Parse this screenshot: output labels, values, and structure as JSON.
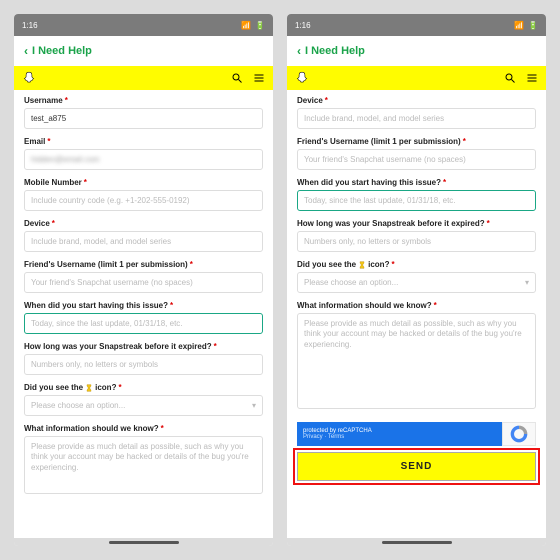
{
  "status": {
    "time": "1:16",
    "wifi": "⊙",
    "battery": "▮"
  },
  "nav": {
    "back": "‹",
    "title": "I Need Help"
  },
  "left": {
    "username_label": "Username",
    "username_value": "test_a875",
    "email_label": "Email",
    "email_value": "hidden@email.com",
    "mobile_label": "Mobile Number",
    "mobile_placeholder": "Include country code (e.g. +1-202-555-0192)",
    "device_label": "Device",
    "device_placeholder": "Include brand, model, and model series",
    "friend_label": "Friend's Username (limit 1 per submission)",
    "friend_placeholder": "Your friend's Snapchat username (no spaces)",
    "when_label": "When did you start having this issue?",
    "when_placeholder": "Today, since the last update, 01/31/18, etc.",
    "howlong_label": "How long was your Snapstreak before it expired?",
    "howlong_placeholder": "Numbers only, no letters or symbols",
    "hourglass_label_before": "Did you see the ",
    "hourglass_label_after": " icon?",
    "select_placeholder": "Please choose an option...",
    "info_label": "What information should we know?",
    "info_placeholder": "Please provide as much detail as possible, such as why you think your account may be hacked or details of the bug you're experiencing."
  },
  "right": {
    "device_label": "Device",
    "device_placeholder": "Include brand, model, and model series",
    "friend_label": "Friend's Username (limit 1 per submission)",
    "friend_placeholder": "Your friend's Snapchat username (no spaces)",
    "when_label": "When did you start having this issue?",
    "when_placeholder": "Today, since the last update, 01/31/18, etc.",
    "howlong_label": "How long was your Snapstreak before it expired?",
    "howlong_placeholder": "Numbers only, no letters or symbols",
    "hourglass_label_before": "Did you see the ",
    "hourglass_label_after": " icon?",
    "select_placeholder": "Please choose an option...",
    "info_label": "What information should we know?",
    "info_placeholder": "Please provide as much detail as possible, such as why you think your account may be hacked or details of the bug you're experiencing.",
    "recaptcha_main": "protected by reCAPTCHA",
    "recaptcha_links": "Privacy · Terms",
    "send": "SEND"
  }
}
